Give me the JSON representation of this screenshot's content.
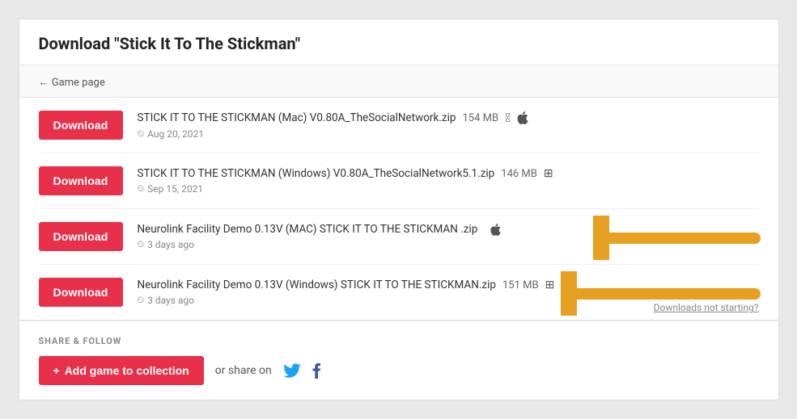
{
  "page": {
    "title_prefix": "Download ",
    "title_game": "\"Stick It To The Stickman\"",
    "back_link": "← Game page",
    "downloads": [
      {
        "id": "row-1",
        "button_label": "Download",
        "filename": "STICK IT TO THE STICKMAN (Mac) V0.80A_TheSocialNetwork.zip",
        "size": "154 MB",
        "platform": "mac",
        "date": "Aug 20, 2021"
      },
      {
        "id": "row-2",
        "button_label": "Download",
        "filename": "STICK IT TO THE STICKMAN (Windows) V0.80A_TheSocialNetwork5.1.zip",
        "size": "146 MB",
        "platform": "windows",
        "date": "Sep 15, 2021"
      },
      {
        "id": "row-3",
        "button_label": "Download",
        "filename": "Neurolink Facility Demo 0.13V (MAC) STICK IT TO THE STICKMAN .zip",
        "size": "",
        "platform": "mac",
        "date": "3 days ago"
      },
      {
        "id": "row-4",
        "button_label": "Download",
        "filename": "Neurolink Facility Demo 0.13V (Windows) STICK IT TO THE STICKMAN.zip",
        "size": "151 MB",
        "platform": "windows",
        "date": "3 days ago"
      }
    ],
    "downloads_not_starting": "Downloads not starting?",
    "share_section": {
      "label": "SHARE & FOLLOW",
      "add_button": "+ Add game to collection",
      "or_share": "or share on"
    }
  }
}
